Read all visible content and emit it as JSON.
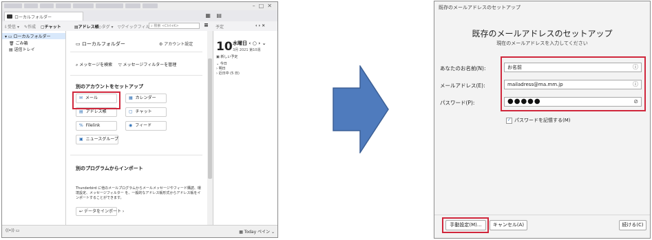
{
  "thunderbird": {
    "tab_label": "ローカルフォルダー",
    "toolbar": {
      "get_messages": "受信",
      "write": "作成",
      "chat": "チャット",
      "address_book": "アドレス帳",
      "tag": "タグ",
      "quick_filter": "クイックフィルター",
      "search_placeholder": "検索 <Ctrl+K>",
      "menu_icon": "≡",
      "calendar_label": "予定"
    },
    "folder_pane": {
      "root": "ローカルフォルダー",
      "items": [
        "ごみ箱",
        "送信トレイ"
      ]
    },
    "main": {
      "header": "ローカルフォルダー",
      "account_settings": "アカウント設定",
      "search_messages": "メッセージを検索",
      "manage_filters": "メッセージフィルターを管理",
      "setup_title": "別のアカウントをセットアップ",
      "accounts": [
        {
          "icon": "✉",
          "label": "メール"
        },
        {
          "icon": "▦",
          "label": "カレンダー"
        },
        {
          "icon": "▤",
          "label": "アドレス帳"
        },
        {
          "icon": "▢",
          "label": "チャット"
        },
        {
          "icon": "%",
          "label": "Filelink"
        },
        {
          "icon": "◉",
          "label": "フィード"
        },
        {
          "icon": "▣",
          "label": "ニュースグループ"
        }
      ],
      "import_title": "別のプログラムからインポート",
      "import_text": "Thunderbird に他のメールプログラムからメールメッセージやフィード購読、環境設定、メッセージフィルター を、一般的なアドレス帳形式からアドレス帳をインポートすることができます。",
      "import_button": "データをインポート"
    },
    "calendar": {
      "header": "予定",
      "nav": "< >",
      "day": "10",
      "weekday": "水曜日",
      "sub": "3月 2021 第10週",
      "new_event": "新しい予定",
      "items": [
        "今日",
        "明日",
        "近日中 (5 日)"
      ]
    },
    "status": {
      "left": "",
      "right": "Today ペイン"
    }
  },
  "dialog": {
    "title": "既存のメールアドレスのセットアップ",
    "heading": "既存のメールアドレスのセットアップ",
    "subheading": "現在のメールアドレスを入力してください",
    "fields": {
      "name_label": "あなたのお名前(N):",
      "name_value": "お名前",
      "email_label": "メールアドレス(E):",
      "email_value": "mailadress@ma.mm.jp",
      "password_label": "パスワード(P):",
      "password_value": "●●●●●"
    },
    "remember_password": "パスワードを記憶する(M)",
    "buttons": {
      "manual": "手動設定(M)...",
      "cancel": "キャンセル(A)",
      "continue": "続ける(C)"
    }
  },
  "colors": {
    "highlight_red": "#d0263b",
    "arrow_blue": "#4f7bbd",
    "arrow_border": "#3b5f95",
    "link_blue": "#2a6db5"
  }
}
